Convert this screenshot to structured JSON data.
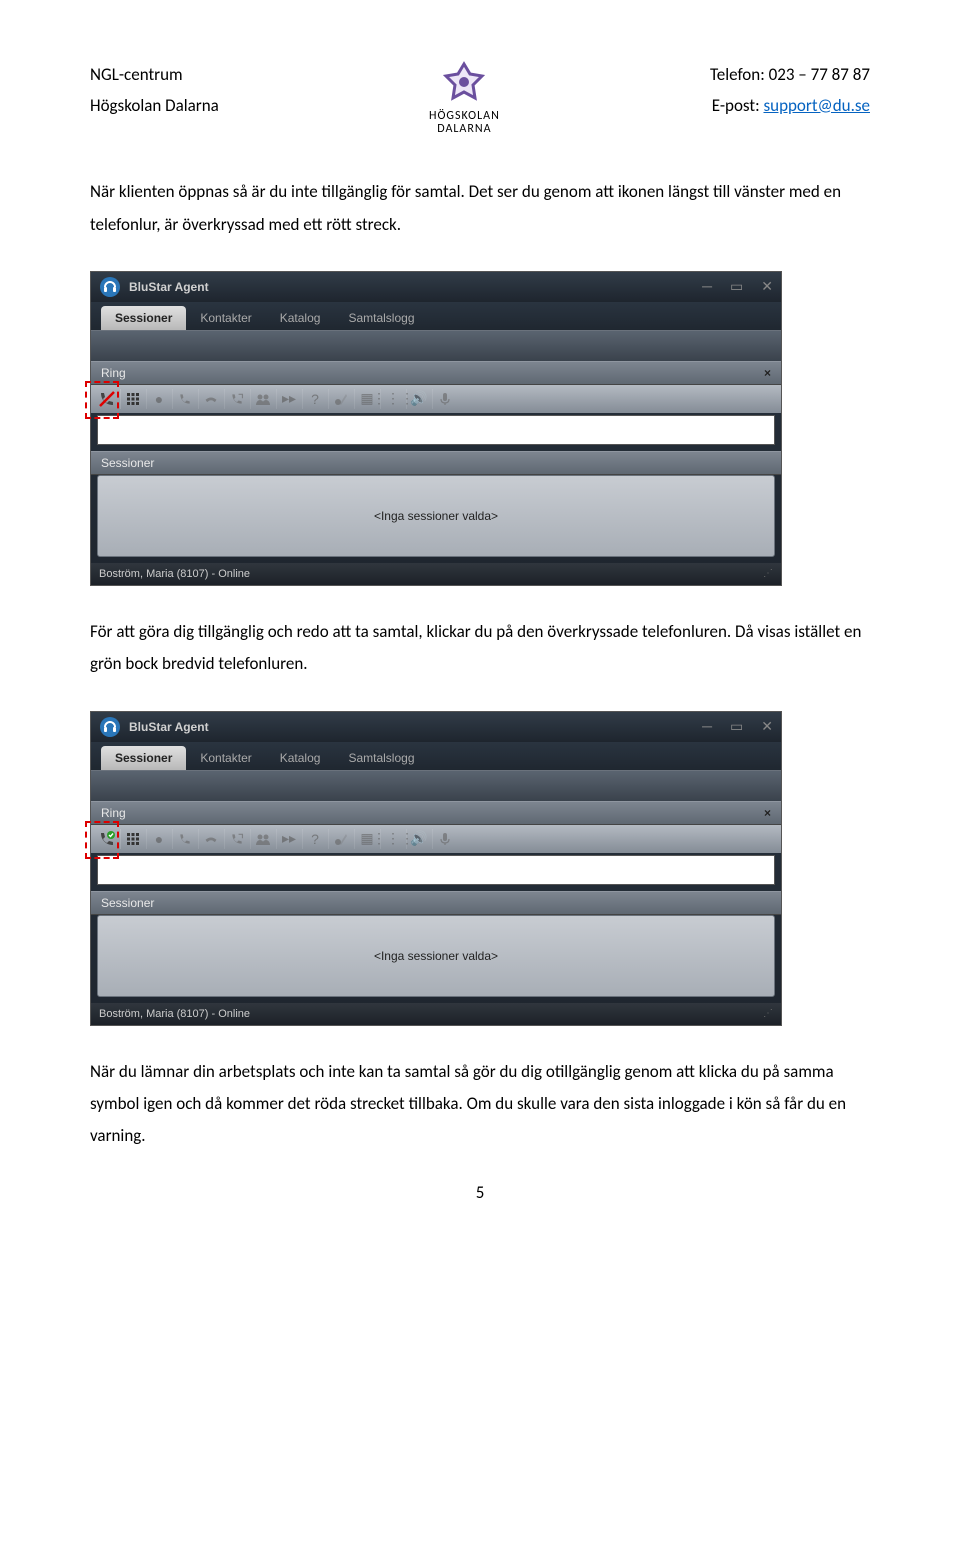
{
  "header": {
    "left_line1": "NGL-centrum",
    "left_line2": "Högskolan Dalarna",
    "logo_text_line1": "HÖGSKOLAN",
    "logo_text_line2": "DALARNA",
    "right_line1_label": "Telefon: ",
    "right_line1_value": "023 – 77 87 87",
    "right_line2_label": "E-post: ",
    "right_line2_email": "support@du.se"
  },
  "para1": "När klienten öppnas så är du inte tillgänglig för samtal. Det ser du genom att ikonen längst till vänster med en telefonlur, är överkryssad med ett rött streck.",
  "para2": "För att göra dig tillgänglig och redo att ta samtal, klickar du på den överkryssade telefonluren. Då visas istället en grön bock bredvid telefonluren.",
  "para3": "När du lämnar din arbetsplats och inte kan ta samtal så gör du dig otillgänglig genom att klicka du på samma symbol igen och då kommer det röda strecket tillbaka. Om du skulle vara den sista inloggade i kön så får du en varning.",
  "app": {
    "title": "BluStar Agent",
    "tabs": [
      "Sessioner",
      "Kontakter",
      "Katalog",
      "Samtalslogg"
    ],
    "ring_label": "Ring",
    "sessions_label": "Sessioner",
    "empty_sessions": "<Inga sessioner valda>",
    "status": "Boström, Maria (8107) - Online"
  },
  "page_number": "5"
}
